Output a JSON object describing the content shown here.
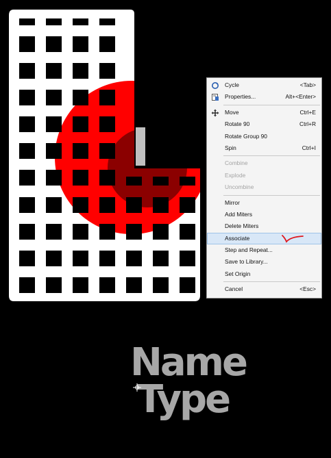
{
  "context_menu": {
    "groups": [
      [
        {
          "label": "Cycle",
          "shortcut": "<Tab>",
          "icon": "cycle-icon",
          "state": "normal"
        },
        {
          "label": "Properties...",
          "shortcut": "Alt+<Enter>",
          "icon": "properties-icon",
          "state": "normal"
        }
      ],
      [
        {
          "label": "Move",
          "shortcut": "Ctrl+E",
          "icon": "move-icon",
          "state": "normal"
        },
        {
          "label": "Rotate 90",
          "shortcut": "Ctrl+R",
          "icon": "",
          "state": "normal"
        },
        {
          "label": "Rotate Group 90",
          "shortcut": "",
          "icon": "",
          "state": "normal"
        },
        {
          "label": "Spin",
          "shortcut": "Ctrl+I",
          "icon": "",
          "state": "normal"
        }
      ],
      [
        {
          "label": "Combine",
          "shortcut": "",
          "icon": "",
          "state": "disabled"
        },
        {
          "label": "Explode",
          "shortcut": "",
          "icon": "",
          "state": "disabled"
        },
        {
          "label": "Uncombine",
          "shortcut": "",
          "icon": "",
          "state": "disabled"
        }
      ],
      [
        {
          "label": "Mirror",
          "shortcut": "",
          "icon": "",
          "state": "normal"
        },
        {
          "label": "Add Miters",
          "shortcut": "",
          "icon": "",
          "state": "normal"
        },
        {
          "label": "Delete Miters",
          "shortcut": "",
          "icon": "",
          "state": "normal"
        },
        {
          "label": "Associate",
          "shortcut": "",
          "icon": "",
          "state": "selected"
        },
        {
          "label": "Step and Repeat...",
          "shortcut": "",
          "icon": "",
          "state": "normal"
        },
        {
          "label": "Save to Library...",
          "shortcut": "",
          "icon": "",
          "state": "normal"
        },
        {
          "label": "Set Origin",
          "shortcut": "",
          "icon": "",
          "state": "normal"
        }
      ],
      [
        {
          "label": "Cancel",
          "shortcut": "<Esc>",
          "icon": "",
          "state": "normal"
        }
      ]
    ],
    "annotation": "red-checkmark"
  },
  "design_text": {
    "line1": "Name",
    "line2": "Type"
  },
  "colors": {
    "background": "#000000",
    "board": "#ffffff",
    "circle_red": "#ff0000",
    "circle_dark": "#8b0000",
    "text_gray": "#a7a7a7",
    "menu_highlight": "#d8e7f7",
    "checkmark": "#e0151b"
  }
}
